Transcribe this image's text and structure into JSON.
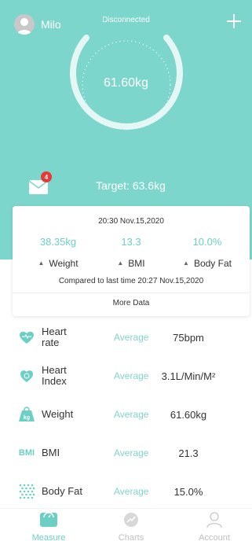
{
  "header": {
    "username": "Milo",
    "status": "Disconnected",
    "current_weight": "61.60kg",
    "target": "Target: 63.6kg",
    "mail_badge": "4"
  },
  "card": {
    "date": "20:30 Nov.15,2020",
    "metrics": [
      {
        "value": "38.35kg",
        "label": "Weight"
      },
      {
        "value": "13.3",
        "label": "BMI"
      },
      {
        "value": "10.0%",
        "label": "Body Fat"
      }
    ],
    "compared": "Compared to last time 20:27 Nov.15,2020",
    "more": "More Data"
  },
  "rows": [
    {
      "label": "Heart rate",
      "status": "Average",
      "value": "75bpm",
      "icon": "heart-icon"
    },
    {
      "label": "Heart Index",
      "status": "Average",
      "value": "3.1L/Min/M²",
      "icon": "heart-index-icon"
    },
    {
      "label": "Weight",
      "status": "Average",
      "value": "61.60kg",
      "icon": "weight-icon"
    },
    {
      "label": "BMI",
      "status": "Average",
      "value": "21.3",
      "icon": "bmi-icon",
      "icon_text": "BMI"
    },
    {
      "label": "Body Fat",
      "status": "Average",
      "value": "15.0%",
      "icon": "body-fat-icon"
    }
  ],
  "nav": {
    "measure": "Measure",
    "charts": "Charts",
    "account": "Account"
  },
  "colors": {
    "accent": "#7dd6cc",
    "accent_text": "#6ccfc4",
    "badge": "#e53935"
  }
}
